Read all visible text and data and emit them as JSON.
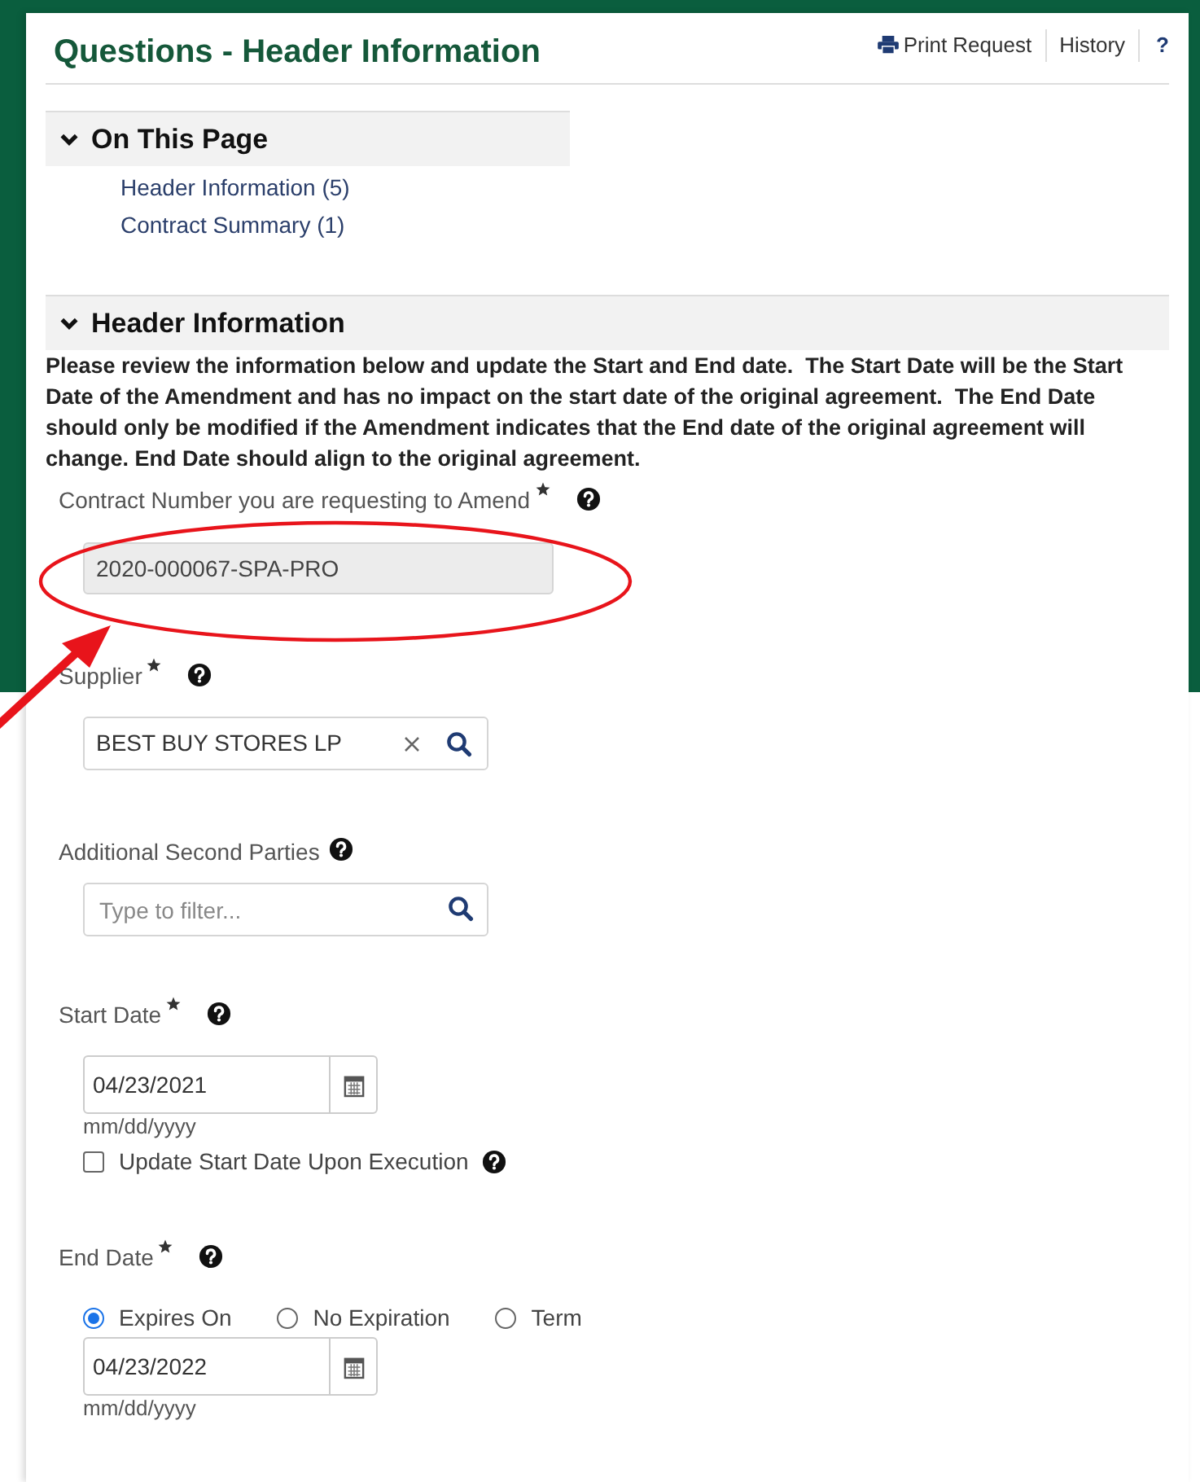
{
  "header": {
    "title": "Questions - Header Information",
    "actions": [
      {
        "kind": "print",
        "label": "Print Request"
      },
      {
        "kind": "link",
        "label": "History"
      },
      {
        "kind": "help",
        "label": "?"
      }
    ]
  },
  "on_this_page": {
    "title": "On This Page",
    "expanded": true,
    "links": [
      "Header Information (5)",
      "Contract Summary (1)"
    ]
  },
  "section": {
    "title": "Header Information",
    "expanded": true,
    "instructions": "Please review the information below and update the Start and End date.  The Start Date will be the Start Date of the Amendment and has no impact on the start date of the original agreement.  The End Date should only be modified if the Amendment indicates that the End date of the original agreement will change. End Date should align to the original agreement."
  },
  "fields": [
    {
      "kind": "readonly",
      "label": "Contract Number you are requesting to Amend",
      "required": true,
      "value": "2020-000067-SPA-PRO"
    },
    {
      "kind": "lookup",
      "label": "Supplier",
      "required": true,
      "value": "BEST BUY STORES LP"
    },
    {
      "kind": "filter",
      "label": "Additional Second Parties",
      "required": false,
      "placeholder": "Type to filter..."
    },
    {
      "kind": "date",
      "label": "Start Date",
      "required": true,
      "value": "04/23/2021",
      "hint": "mm/dd/yyyy",
      "checkbox": {
        "label": "Update Start Date Upon Execution",
        "checked": false
      }
    },
    {
      "kind": "enddate",
      "label": "End Date",
      "required": true,
      "options": [
        {
          "label": "Expires On",
          "selected": true
        },
        {
          "label": "No Expiration",
          "selected": false
        },
        {
          "label": "Term",
          "selected": false
        }
      ],
      "value": "04/23/2022",
      "hint": "mm/dd/yyyy"
    }
  ]
}
